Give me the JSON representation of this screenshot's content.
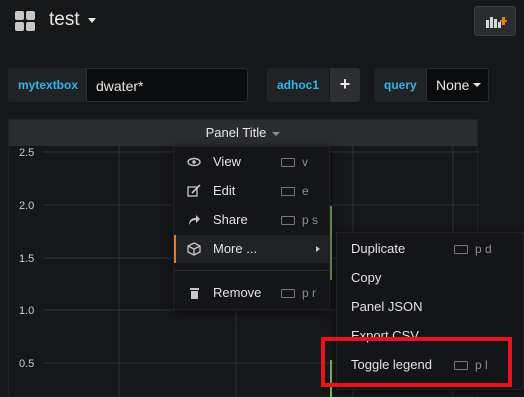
{
  "header": {
    "dashboard_title": "test"
  },
  "variables": {
    "mytextbox_label": "mytextbox",
    "mytextbox_value": "dwater*",
    "adhoc_label": "adhoc1",
    "adhoc_add": "+",
    "query_label": "query",
    "query_value": "None"
  },
  "panel": {
    "title": "Panel Title",
    "y_ticks": [
      "2.5",
      "2.0",
      "1.5",
      "1.0",
      "0.5"
    ]
  },
  "panel_menu": {
    "items": [
      {
        "label": "View",
        "shortcut": "v",
        "icon": "eye-icon"
      },
      {
        "label": "Edit",
        "shortcut": "e",
        "icon": "edit-icon"
      },
      {
        "label": "Share",
        "shortcut": "p s",
        "icon": "share-icon"
      },
      {
        "label": "More ...",
        "shortcut": "",
        "icon": "cube-icon"
      },
      {
        "label": "Remove",
        "shortcut": "p r",
        "icon": "trash-icon"
      }
    ]
  },
  "more_submenu": {
    "items": [
      {
        "label": "Duplicate",
        "shortcut": "p d"
      },
      {
        "label": "Copy",
        "shortcut": ""
      },
      {
        "label": "Panel JSON",
        "shortcut": ""
      },
      {
        "label": "Export CSV",
        "shortcut": ""
      },
      {
        "label": "Toggle legend",
        "shortcut": "p l"
      }
    ]
  },
  "colors": {
    "accent_blue": "#33b5e5",
    "active_orange": "#eb7b18",
    "highlight_red": "#e8141b",
    "series_green": "#7eb26d"
  }
}
